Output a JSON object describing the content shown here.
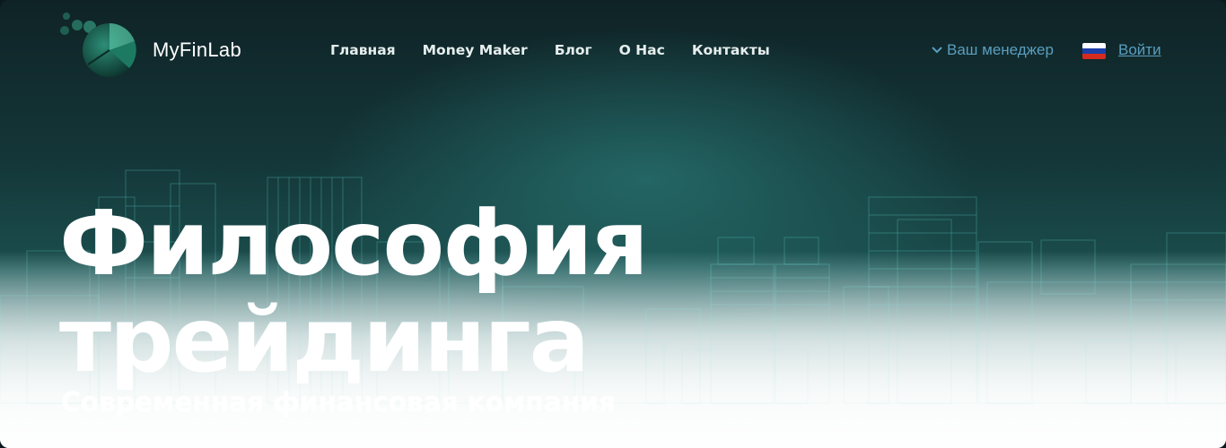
{
  "header": {
    "brand": "MyFinLab",
    "nav": [
      "Главная",
      "Money Maker",
      "Блог",
      "О Нас",
      "Контакты"
    ],
    "manager_label": "Ваш менеджер",
    "language_flag": "ru-flag",
    "login_label": "Войти"
  },
  "hero": {
    "title_line1": "Философия",
    "title_line2": "трейдинга",
    "subtitle": "Современная финансовая компания"
  },
  "colors": {
    "accent_link": "#5a9ec0",
    "background_dark": "#0f2326",
    "teal_glow": "#266e6c"
  }
}
